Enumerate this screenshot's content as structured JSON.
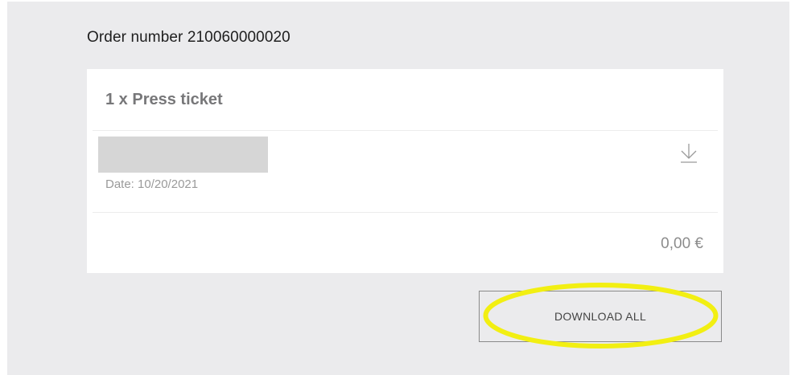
{
  "order": {
    "title": "Order number 210060000020"
  },
  "ticket_group": {
    "header": "1 x Press ticket",
    "ticket": {
      "date": "Date: 10/20/2021",
      "download_icon": "download-arrow-icon"
    },
    "total": "0,00 €"
  },
  "actions": {
    "download_all_label": "DOWNLOAD ALL"
  },
  "colors": {
    "panel_background": "#ebebed",
    "card_background": "#ffffff",
    "highlight_ring": "#f2ef12",
    "redaction": "#d6d6d6"
  }
}
